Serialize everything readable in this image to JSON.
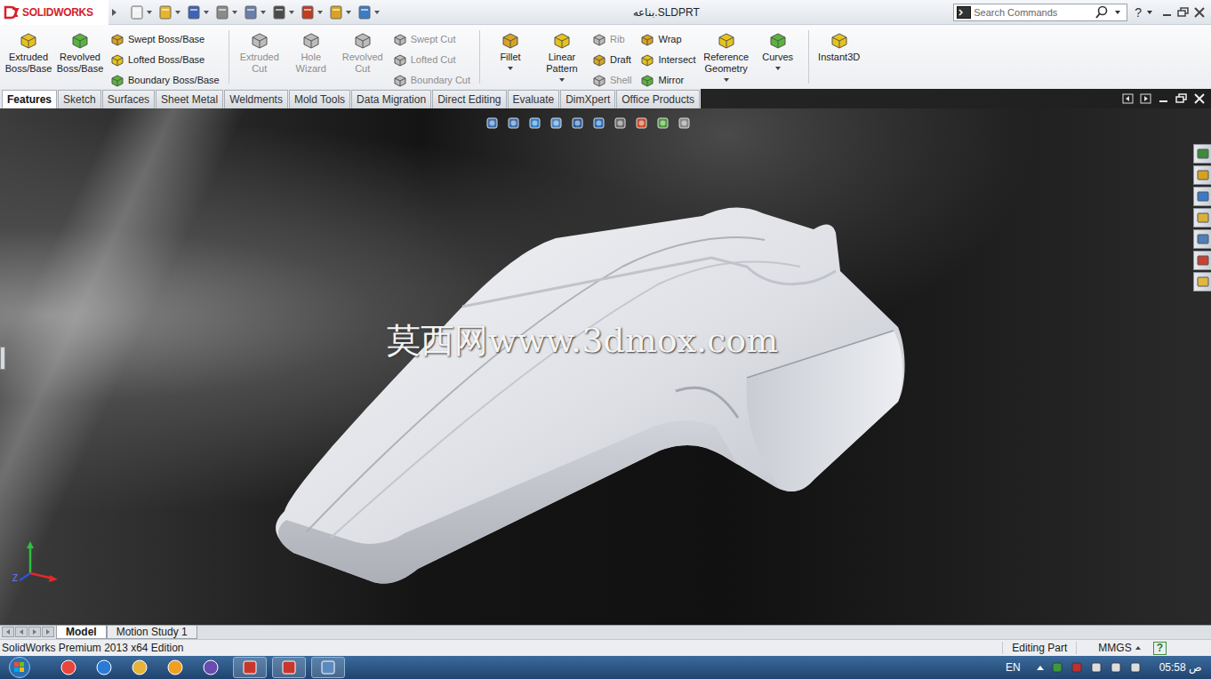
{
  "titlebar": {
    "logo": "SOLIDWORKS",
    "title": "بناعه.SLDPRT",
    "search_placeholder": "Search Commands",
    "help": "?"
  },
  "ribbon": {
    "groups": [
      {
        "columns": [
          {
            "kind": "large",
            "items": [
              {
                "label": "Extruded Boss/Base",
                "disabled": false,
                "dropdown": false
              }
            ]
          },
          {
            "kind": "large",
            "items": [
              {
                "label": "Revolved Boss/Base",
                "disabled": false,
                "dropdown": false
              }
            ]
          },
          {
            "kind": "small",
            "items": [
              {
                "label": "Swept Boss/Base",
                "disabled": false,
                "dropdown": false
              },
              {
                "label": "Lofted Boss/Base",
                "disabled": false,
                "dropdown": false
              },
              {
                "label": "Boundary Boss/Base",
                "disabled": false,
                "dropdown": false
              }
            ]
          }
        ]
      },
      {
        "columns": [
          {
            "kind": "large",
            "items": [
              {
                "label": "Extruded Cut",
                "disabled": true,
                "dropdown": false
              }
            ]
          },
          {
            "kind": "large",
            "items": [
              {
                "label": "Hole Wizard",
                "disabled": true,
                "dropdown": false
              }
            ]
          },
          {
            "kind": "large",
            "items": [
              {
                "label": "Revolved Cut",
                "disabled": true,
                "dropdown": false
              }
            ]
          },
          {
            "kind": "small",
            "items": [
              {
                "label": "Swept Cut",
                "disabled": true,
                "dropdown": false
              },
              {
                "label": "Lofted Cut",
                "disabled": true,
                "dropdown": false
              },
              {
                "label": "Boundary Cut",
                "disabled": true,
                "dropdown": false
              }
            ]
          }
        ]
      },
      {
        "columns": [
          {
            "kind": "large",
            "items": [
              {
                "label": "Fillet",
                "disabled": false,
                "dropdown": true
              }
            ]
          },
          {
            "kind": "large",
            "items": [
              {
                "label": "Linear Pattern",
                "disabled": false,
                "dropdown": true
              }
            ]
          },
          {
            "kind": "small",
            "items": [
              {
                "label": "Rib",
                "disabled": true,
                "dropdown": false
              },
              {
                "label": "Draft",
                "disabled": false,
                "dropdown": false
              },
              {
                "label": "Shell",
                "disabled": true,
                "dropdown": false
              }
            ]
          },
          {
            "kind": "small",
            "items": [
              {
                "label": "Wrap",
                "disabled": false,
                "dropdown": false
              },
              {
                "label": "Intersect",
                "disabled": false,
                "dropdown": false
              },
              {
                "label": "Mirror",
                "disabled": false,
                "dropdown": false
              }
            ]
          },
          {
            "kind": "large",
            "items": [
              {
                "label": "Reference Geometry",
                "disabled": false,
                "dropdown": true
              }
            ]
          },
          {
            "kind": "large",
            "items": [
              {
                "label": "Curves",
                "disabled": false,
                "dropdown": true
              }
            ]
          }
        ]
      },
      {
        "columns": [
          {
            "kind": "large",
            "items": [
              {
                "label": "Instant3D",
                "disabled": false,
                "dropdown": false
              }
            ]
          }
        ]
      }
    ]
  },
  "tabs": [
    {
      "label": "Features",
      "selected": true
    },
    {
      "label": "Sketch",
      "selected": false
    },
    {
      "label": "Surfaces",
      "selected": false
    },
    {
      "label": "Sheet Metal",
      "selected": false
    },
    {
      "label": "Weldments",
      "selected": false
    },
    {
      "label": "Mold Tools",
      "selected": false
    },
    {
      "label": "Data Migration",
      "selected": false
    },
    {
      "label": "Direct Editing",
      "selected": false
    },
    {
      "label": "Evaluate",
      "selected": false
    },
    {
      "label": "DimXpert",
      "selected": false
    },
    {
      "label": "Office Products",
      "selected": false
    }
  ],
  "viewport": {
    "watermark": "莫西网www.3dmox.com",
    "triad_label": "Z"
  },
  "view_tabs": [
    {
      "label": "Model",
      "selected": true
    },
    {
      "label": "Motion Study 1",
      "selected": false
    }
  ],
  "status_bar": {
    "edition": "SolidWorks Premium 2013 x64 Edition",
    "mode": "Editing Part",
    "units": "MMGS",
    "help": "?"
  },
  "taskbar": {
    "language": "EN",
    "time": "05:58",
    "period": "ص"
  }
}
